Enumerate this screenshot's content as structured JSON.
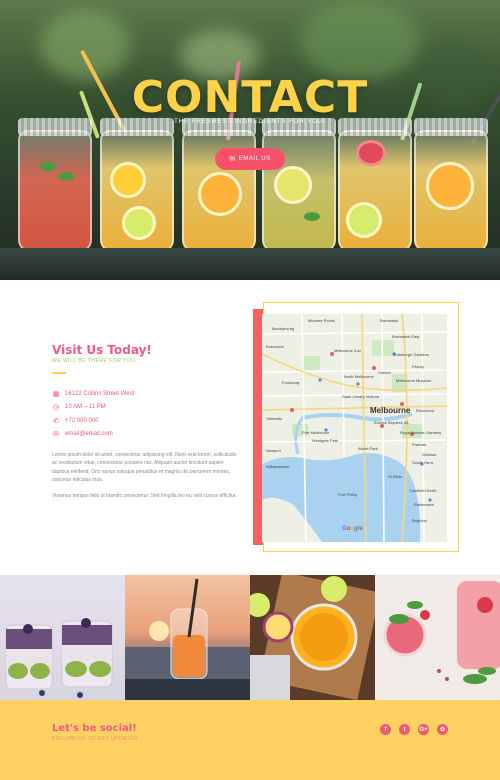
{
  "hero": {
    "title": "CONTACT",
    "subtitle": "THE FRESHEST INGREDIENTS FOR YOU!",
    "button_label": "EMAIL US"
  },
  "contact": {
    "title": "Visit Us Today!",
    "tagline": "WE WILL BE THERE FOR YOU",
    "address": "16122 Collins Street West",
    "hours": "10 AM – 11 PM",
    "phone": "+72 000 000",
    "email": "email@email.com",
    "paragraph1": "Lorem ipsum dolor sit amet, consectetur adipiscing elit. Nunc erat lorem, sollicitudin ac vestibulum vitae, consectetur posuere nisi. Aliquam auctor tincidunt sapien dapibus eleifend. Orci varius natoque penatibus et magnis dis parturient montes, nascetur ridiculus mus.",
    "paragraph2": "Vivamus tempus felis ut blandit consectetur. Sed fringilla leo eu velit cursus efficitur."
  },
  "map": {
    "city": "Melbourne",
    "labels": [
      "Moonee Ponds",
      "Brunswick",
      "Maribyrnong",
      "Brunswick East",
      "Essendon",
      "Melbourne Zoo",
      "Edinburgh Gardens",
      "Footscray",
      "North Melbourne",
      "Melbourne Museum",
      "Carlton",
      "Fitzroy",
      "Yarraville",
      "State Library Victoria",
      "Richmond",
      "Port Melbourne",
      "Eureka Skydeck 88",
      "South Yarra",
      "Williamstown",
      "St Kilda",
      "Albert Park",
      "Prahran",
      "Newport",
      "Caulfield North",
      "Royal Botanic Gardens",
      "Westgate Park",
      "Elsternwick",
      "Brighton",
      "Port Phillip",
      "Windsor"
    ],
    "attribution": "Google"
  },
  "footer": {
    "title": "Let's be social!",
    "subtitle": "FOLLOW US TO GET UPDATES",
    "social": [
      "f",
      "t",
      "G+",
      "✿"
    ]
  },
  "colors": {
    "accent_pink": "#ef5a86",
    "button_red": "#f5516b",
    "title_yellow": "#ffd24a",
    "footer_yellow": "#ffd162",
    "tag_green": "#9fcf5a"
  }
}
